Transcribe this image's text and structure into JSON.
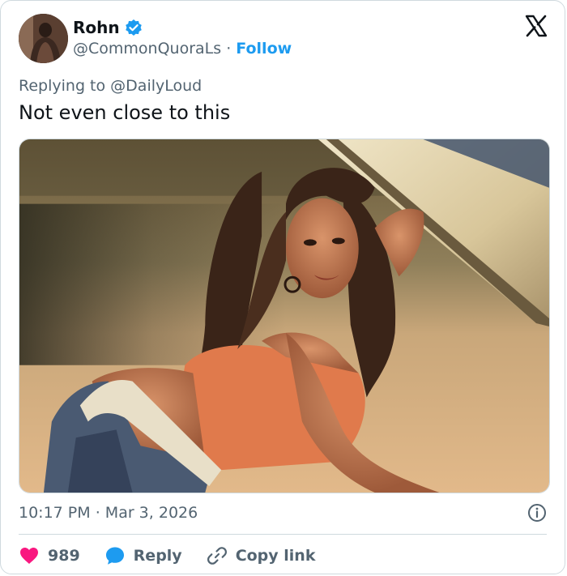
{
  "author": {
    "display_name": "Rohn",
    "handle": "@CommonQuoraLs",
    "separator": "·",
    "follow_label": "Follow",
    "verified_color": "#1d9bf0"
  },
  "replying_to": {
    "prefix": "Replying to",
    "mention": "@DailyLoud"
  },
  "tweet": {
    "text": "Not even close to this"
  },
  "meta": {
    "time": "10:17 PM",
    "separator": "·",
    "date": "Mar 3, 2026"
  },
  "actions": {
    "likes_count": "989",
    "reply_label": "Reply",
    "copy_link_label": "Copy link",
    "like_color": "#f91880",
    "reply_color": "#1d9bf0"
  },
  "icons": [
    "verified-badge-icon",
    "x-logo-icon",
    "info-icon",
    "heart-icon",
    "reply-bubble-icon",
    "link-icon"
  ]
}
